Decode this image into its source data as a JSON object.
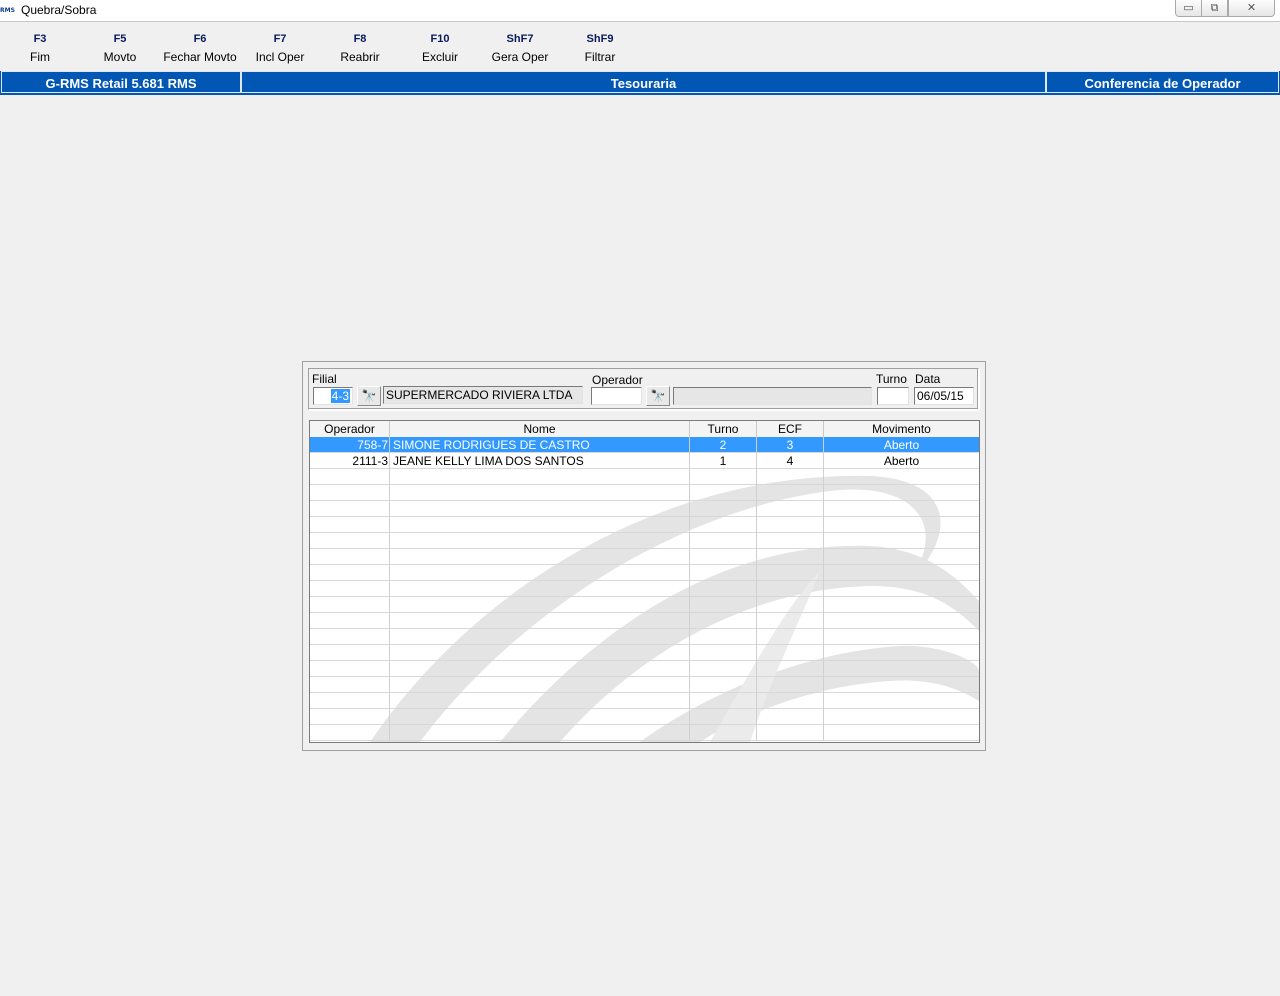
{
  "window": {
    "title": "Quebra/Sobra",
    "icon_text": "RMS",
    "minimize_icon": "minimize-icon",
    "maximize_icon": "restore-icon",
    "close_icon": "close-icon",
    "minimize_glyph": "▭",
    "maximize_glyph": "⧉",
    "close_glyph": "✕"
  },
  "toolbar": {
    "keys": [
      {
        "key": "F3",
        "label": "Fim"
      },
      {
        "key": "F5",
        "label": "Movto"
      },
      {
        "key": "F6",
        "label": "Fechar Movto"
      },
      {
        "key": "F7",
        "label": "Incl Oper"
      },
      {
        "key": "F8",
        "label": "Reabrir"
      },
      {
        "key": "F10",
        "label": "Excluir"
      },
      {
        "key": "ShF7",
        "label": "Gera Oper"
      },
      {
        "key": "ShF9",
        "label": "Filtrar"
      }
    ]
  },
  "header": {
    "left": "G-RMS Retail 5.681 RMS",
    "center": "Tesouraria",
    "right": "Conferencia de Operador",
    "color": "#0157b3"
  },
  "filter": {
    "filial_label": "Filial",
    "filial_value": "4-3",
    "filial_name": "SUPERMERCADO RIVIERA LTDA",
    "operador_label": "Operador",
    "operador_value": "",
    "operador_name": "",
    "turno_label": "Turno",
    "turno_value": "",
    "data_label": "Data",
    "data_value": "06/05/15",
    "search_icon": "binoculars-icon",
    "search_glyph": "🔭"
  },
  "grid": {
    "columns": [
      "Operador",
      "Nome",
      "Turno",
      "ECF",
      "Movimento"
    ],
    "rows": [
      {
        "operador": "758-7",
        "nome": "SIMONE RODRIGUES DE CASTRO",
        "turno": "2",
        "ecf": "3",
        "movimento": "Aberto",
        "selected": true
      },
      {
        "operador": "2111-3",
        "nome": "JEANE KELLY LIMA DOS SANTOS",
        "turno": "1",
        "ecf": "4",
        "movimento": "Aberto",
        "selected": false
      }
    ],
    "selection_color": "#3399ff"
  }
}
